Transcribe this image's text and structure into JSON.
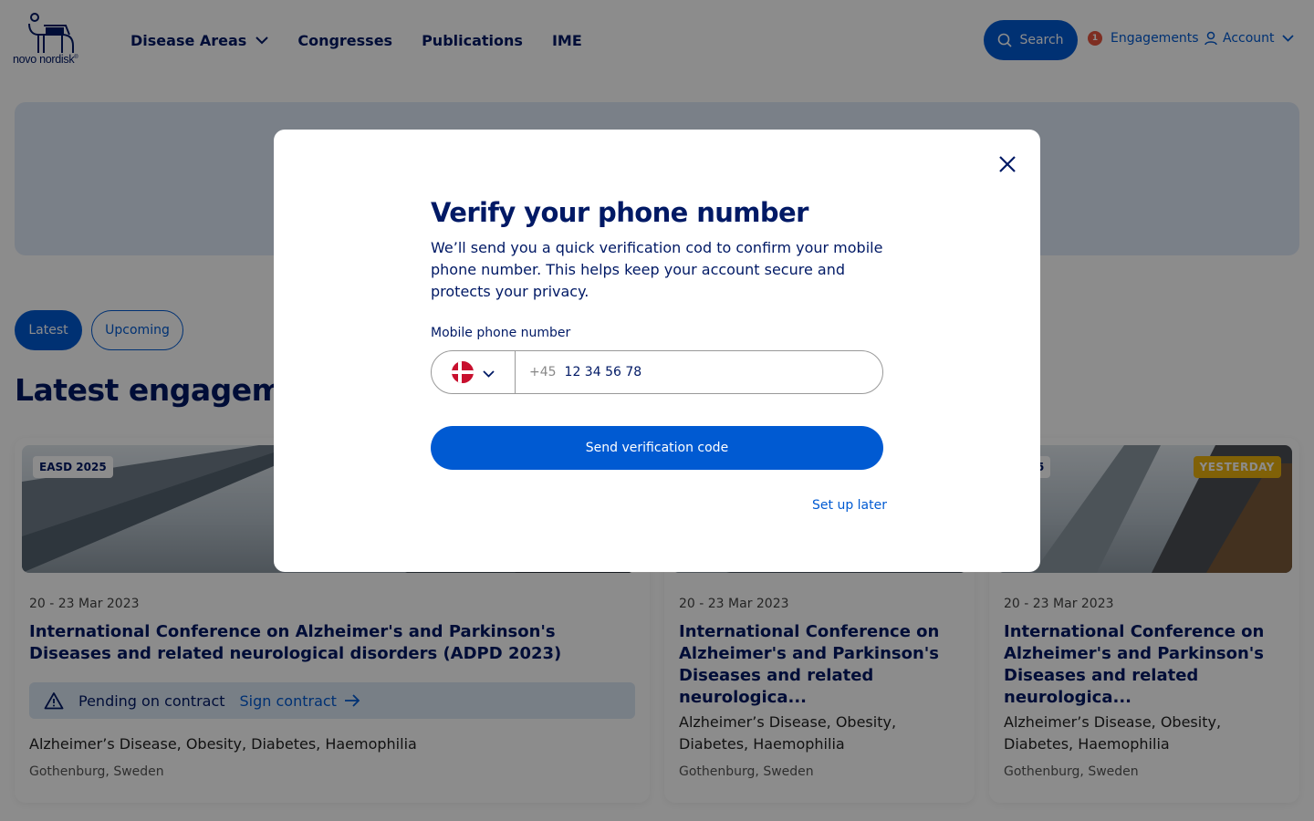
{
  "brand": {
    "name": "novo nordisk",
    "mark": "®"
  },
  "nav": {
    "disease_areas": "Disease Areas",
    "congresses": "Congresses",
    "publications": "Publications",
    "ime": "IME"
  },
  "header": {
    "search_label": "Search",
    "engagements_count": "1",
    "engagements_label": "Engagements",
    "account_label": "Account"
  },
  "filters": {
    "latest": "Latest",
    "upcoming": "Upcoming"
  },
  "section_title": "Latest engagements",
  "cards": [
    {
      "tag": "EASD 2025",
      "date": "20 - 23 Mar 2023",
      "title": "International Conference on Alzheimer's and Parkinson's Diseases and related neurological disorders (ADPD 2023)",
      "pending_label": "Pending on contract",
      "sign_label": "Sign contract",
      "areas": "Alzheimer’s Disease, Obesity, Diabetes, Haemophilia",
      "location": "Gothenburg, Sweden"
    },
    {
      "date": "20 - 23 Mar 2023",
      "title": "International Conference on Alzheimer's and Parkinson's Diseases and related neurologica...",
      "areas": "Alzheimer’s Disease, Obesity, Diabetes, Haemophilia",
      "location": "Gothenburg, Sweden"
    },
    {
      "tag": "2025",
      "status": "YESTERDAY",
      "date": "20 - 23 Mar 2023",
      "title": "International Conference on Alzheimer's and Parkinson's Diseases and related neurologica...",
      "areas": "Alzheimer’s Disease, Obesity, Diabetes, Haemophilia",
      "location": "Gothenburg, Sweden"
    }
  ],
  "modal": {
    "title": "Verify your phone number",
    "description": "We’ll send you a quick verification cod to confirm your mobile phone number. This helps keep your account secure and protects your privacy.",
    "field_label": "Mobile phone number",
    "country_code": "+45",
    "phone_value": "12 34 56 78",
    "send_button": "Send verification code",
    "later_link": "Set up later"
  },
  "colors": {
    "brand_navy": "#001965",
    "primary_blue": "#005ad2",
    "badge_red": "#e6553f",
    "yesterday_yellow": "#eab10e",
    "flag_red": "#c8102e"
  },
  "icons": {
    "logo": "apis-bull-icon",
    "search": "search-icon",
    "account": "user-icon",
    "close": "close-icon",
    "warning": "warning-triangle-icon",
    "arrow": "arrow-right-icon",
    "flag": "denmark-flag-icon"
  }
}
